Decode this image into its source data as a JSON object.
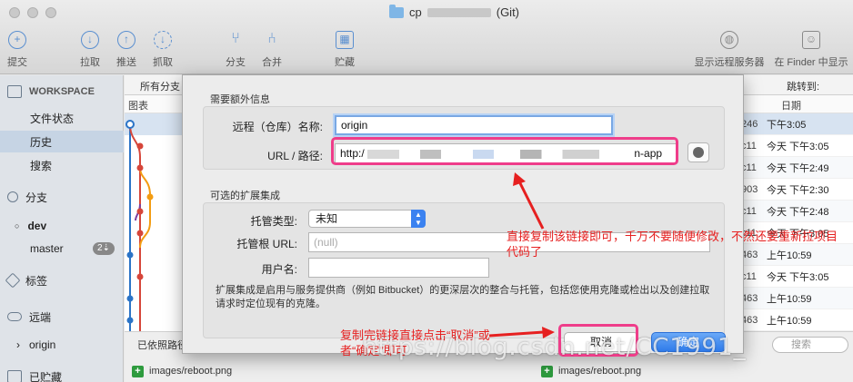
{
  "window": {
    "title_prefix": "cp",
    "title_suffix": "(Git)"
  },
  "toolbar": {
    "commit": "提交",
    "pull": "拉取",
    "push": "推送",
    "fetch": "抓取",
    "branch": "分支",
    "merge": "合并",
    "stash": "贮藏",
    "show_remote": "显示远程服务器",
    "show_finder": "在 Finder 中显示"
  },
  "sidebar": {
    "workspace": "WORKSPACE",
    "file_status": "文件状态",
    "history": "历史",
    "search": "搜索",
    "branches": "分支",
    "branch_dev": "dev",
    "branch_master": "master",
    "master_badge": "2⇣",
    "tags": "标签",
    "remotes": "远端",
    "remote_origin": "origin",
    "stashes": "已贮藏"
  },
  "main": {
    "all_branches": "所有分支",
    "jump_to": "跳转到:",
    "graph_header": "图表",
    "date_header": "日期",
    "sort_text": "已依照路径",
    "file1": "images/reboot.png",
    "file2": "images/reboot.png",
    "search_placeholder": "搜索",
    "rows": [
      {
        "hash": "246",
        "date": "下午3:05"
      },
      {
        "hash": "c11",
        "date": "今天 下午3:05"
      },
      {
        "hash": "c11",
        "date": "今天 下午2:49"
      },
      {
        "hash": "903",
        "date": "今天 下午2:30"
      },
      {
        "hash": "c11",
        "date": "今天 下午2:48"
      },
      {
        "hash": "c11",
        "date": "今天 下午3:05"
      },
      {
        "hash": "463",
        "date": "上午10:59"
      },
      {
        "hash": "c11",
        "date": "今天 下午3:05"
      },
      {
        "hash": "463",
        "date": "上午10:59"
      },
      {
        "hash": "463",
        "date": "上午10:59"
      }
    ]
  },
  "dialog": {
    "section_required": "需要额外信息",
    "remote_name_label": "远程（仓库）名称:",
    "remote_name_value": "origin",
    "url_label": "URL / 路径:",
    "url_start": "http:/",
    "url_end": "n-app",
    "section_optional": "可选的扩展集成",
    "hosting_type_label": "托管类型:",
    "hosting_type_value": "未知",
    "hosting_root_label": "托管根 URL:",
    "hosting_root_placeholder": "(null)",
    "username_label": "用户名:",
    "description": "扩展集成是启用与服务提供商（例如 Bitbucket）的更深层次的整合与托管，包括您使用克隆或检出以及创建拉取请求时定位现有的克隆。",
    "cancel": "取消",
    "ok": "确定"
  },
  "annotations": {
    "note1": "直接复制该链接即可，千万不要随便修改，不然还要重新拉项目代码了",
    "note2": "复制完链接直接点击“取消”或者“确定”即可",
    "watermark": "https://blog.csdn.net/CC1991_"
  },
  "colors": {
    "highlight": "#ef3d8a",
    "annotation": "#e62020",
    "accent": "#3b82f0"
  }
}
